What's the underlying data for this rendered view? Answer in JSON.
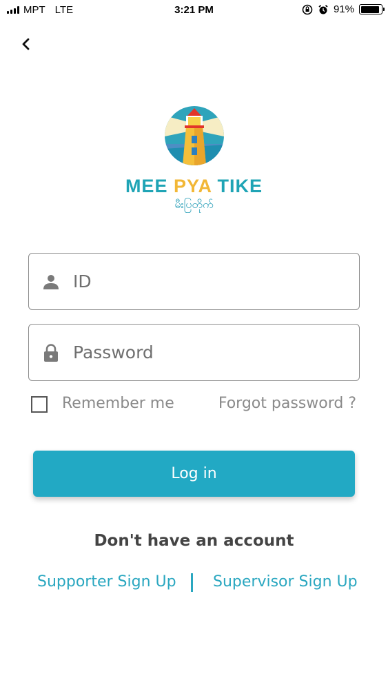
{
  "status_bar": {
    "carrier": "MPT",
    "network": "LTE",
    "time": "3:21 PM",
    "battery_percent": "91%",
    "battery_level": 0.91,
    "icons": [
      "signal-bars-icon",
      "orientation-lock-icon",
      "alarm-icon",
      "battery-icon"
    ]
  },
  "nav": {
    "back_icon": "chevron-left-icon"
  },
  "brand": {
    "name": "MEE PYA TIKE",
    "subtitle": "မီးပြတိုက်",
    "logo": "lighthouse-logo",
    "colors": {
      "mee": "#1fa4b5",
      "pya": "#f2b736",
      "tike": "#1fa4b5"
    },
    "name_parts": [
      "MEE",
      "PYA",
      "TIKE"
    ]
  },
  "form": {
    "id_placeholder": "ID",
    "password_placeholder": "Password",
    "id_icon": "person-icon",
    "password_icon": "lock-icon",
    "remember_label": "Remember me",
    "remember_checked": false,
    "forgot_label": "Forgot password ?",
    "login_label": "Log in"
  },
  "signup": {
    "prompt": "Don't have an account",
    "supporter_label": "Supporter Sign Up",
    "supervisor_label": "Supervisor Sign Up"
  },
  "colors": {
    "accent": "#22a9c4",
    "link": "#2aa7c0",
    "muted_text": "#8a8a8a"
  }
}
